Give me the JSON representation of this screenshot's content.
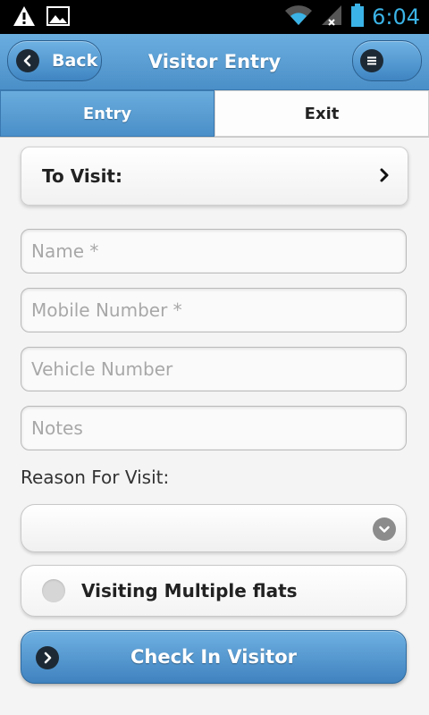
{
  "status_bar": {
    "time": "6:04",
    "icons": [
      "warning-icon",
      "image-icon",
      "wifi-icon",
      "signal-icon",
      "battery-icon"
    ]
  },
  "header": {
    "title": "Visitor Entry",
    "back_label": "Back",
    "accent_color": "#4b8fc8"
  },
  "tabs": [
    {
      "label": "Entry",
      "active": true
    },
    {
      "label": "Exit",
      "active": false
    }
  ],
  "form": {
    "to_visit_label": "To Visit:",
    "name_placeholder": "Name *",
    "mobile_placeholder": "Mobile Number *",
    "vehicle_placeholder": "Vehicle Number",
    "notes_placeholder": "Notes",
    "reason_label": "Reason For Visit:",
    "reason_selected": "",
    "multiple_flats_label": "Visiting Multiple flats",
    "multiple_flats_checked": false,
    "submit_label": "Check In Visitor"
  }
}
